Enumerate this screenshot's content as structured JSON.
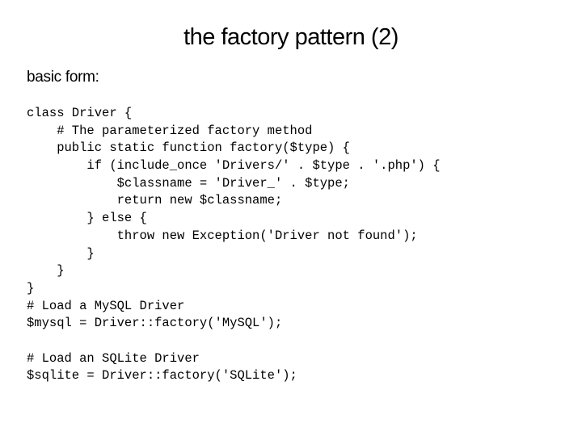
{
  "slide": {
    "title": "the factory pattern (2)",
    "subtitle": "basic form:",
    "code_lines": [
      "class Driver {",
      "    # The parameterized factory method",
      "    public static function factory($type) {",
      "        if (include_once 'Drivers/' . $type . '.php') {",
      "            $classname = 'Driver_' . $type;",
      "            return new $classname;",
      "        } else {",
      "            throw new Exception('Driver not found');",
      "        }",
      "    }",
      "}",
      "# Load a MySQL Driver",
      "$mysql = Driver::factory('MySQL');",
      "",
      "# Load an SQLite Driver",
      "$sqlite = Driver::factory('SQLite');"
    ]
  }
}
